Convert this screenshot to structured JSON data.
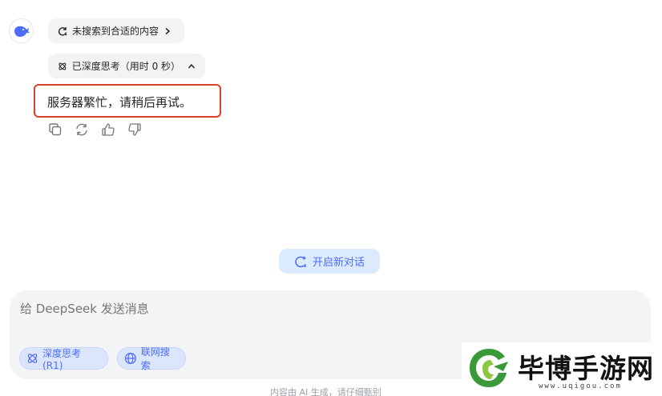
{
  "assistant": {
    "avatar_icon": "deepseek-whale-icon"
  },
  "search_status": {
    "label": "未搜索到合适的内容",
    "icon": "refresh-search-icon",
    "chevron_icon": "chevron-right-icon"
  },
  "thinking_status": {
    "label": "已深度思考（用时 0 秒）",
    "icon": "atom-icon",
    "chevron_icon": "chevron-up-icon"
  },
  "answer": {
    "text": "服务器繁忙，请稍后再试。",
    "highlight_color": "#d9412e"
  },
  "message_actions": [
    {
      "name": "copy",
      "icon": "copy-icon"
    },
    {
      "name": "regenerate",
      "icon": "regenerate-icon"
    },
    {
      "name": "like",
      "icon": "thumbs-up-icon"
    },
    {
      "name": "dislike",
      "icon": "thumbs-down-icon"
    }
  ],
  "new_chat": {
    "label": "开启新对话",
    "icon": "new-chat-icon"
  },
  "composer": {
    "placeholder": "给 DeepSeek 发送消息",
    "deep_think_label": "深度思考 (R1)",
    "web_search_label": "联网搜索"
  },
  "footer": {
    "note": "内容由 AI 生成，请仔细甄别"
  },
  "watermark": {
    "title": "毕博手游网",
    "url": "www.uqigou.com"
  },
  "colors": {
    "accent": "#4d6bfe",
    "pill_bg": "#f2f3f5",
    "chip_bg": "#dbe6fd",
    "composer_bg": "#f3f4f6"
  }
}
